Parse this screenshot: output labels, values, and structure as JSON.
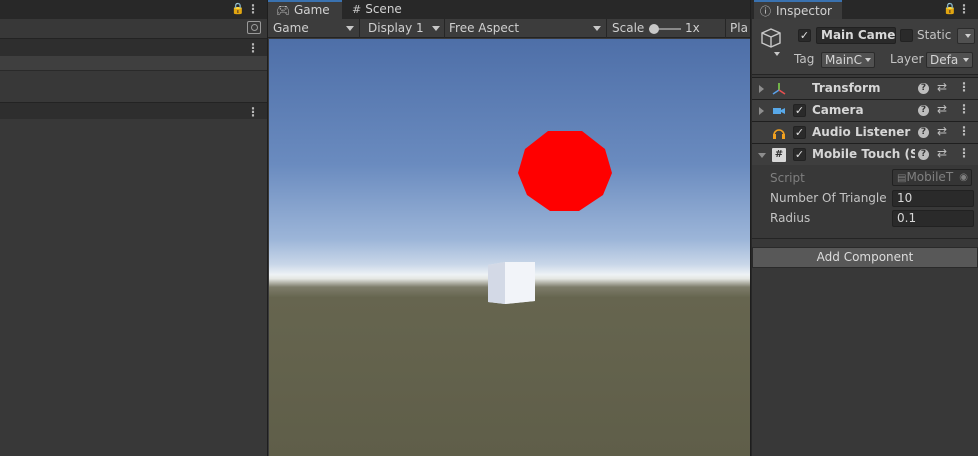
{
  "game_panel": {
    "tabs": [
      {
        "label": "Game",
        "icon": "gamepad-icon"
      },
      {
        "label": "Scene",
        "icon": "hash-icon"
      }
    ],
    "toolbar": {
      "mode": "Game",
      "display": "Display 1",
      "aspect": "Free Aspect",
      "scale_label": "Scale",
      "scale_value": "1x",
      "play_label": "Pla"
    },
    "scene": {
      "sky_colors": [
        "#4e6fa8",
        "#c8d6e8",
        "#eef2f5"
      ],
      "ground_color": "#5f5e49",
      "ball_color": "#ff0000",
      "cube_color": "#e8ecf4"
    }
  },
  "inspector": {
    "tab_label": "Inspector",
    "tab_icon": "info-icon",
    "object": {
      "name": "Main Camera",
      "active": true,
      "static_label": "Static",
      "static": false,
      "tag_label": "Tag",
      "tag_value": "MainC",
      "layer_label": "Layer",
      "layer_value": "Defa"
    },
    "components": [
      {
        "name": "Transform",
        "icon": "transform-icon",
        "has_checkbox": false,
        "expanded": false
      },
      {
        "name": "Camera",
        "icon": "camera-icon",
        "has_checkbox": true,
        "expanded": false
      },
      {
        "name": "Audio Listener",
        "icon": "headphones-icon",
        "has_checkbox": true,
        "expanded": false
      },
      {
        "name": "Mobile Touch (Sc",
        "icon": "script-hash-icon",
        "has_checkbox": true,
        "expanded": true
      }
    ],
    "script_fields": {
      "script_label": "Script",
      "script_value": "MobileT",
      "triangles_label": "Number Of Triangle",
      "triangles_value": "10",
      "radius_label": "Radius",
      "radius_value": "0.1"
    },
    "add_component_label": "Add Component"
  }
}
